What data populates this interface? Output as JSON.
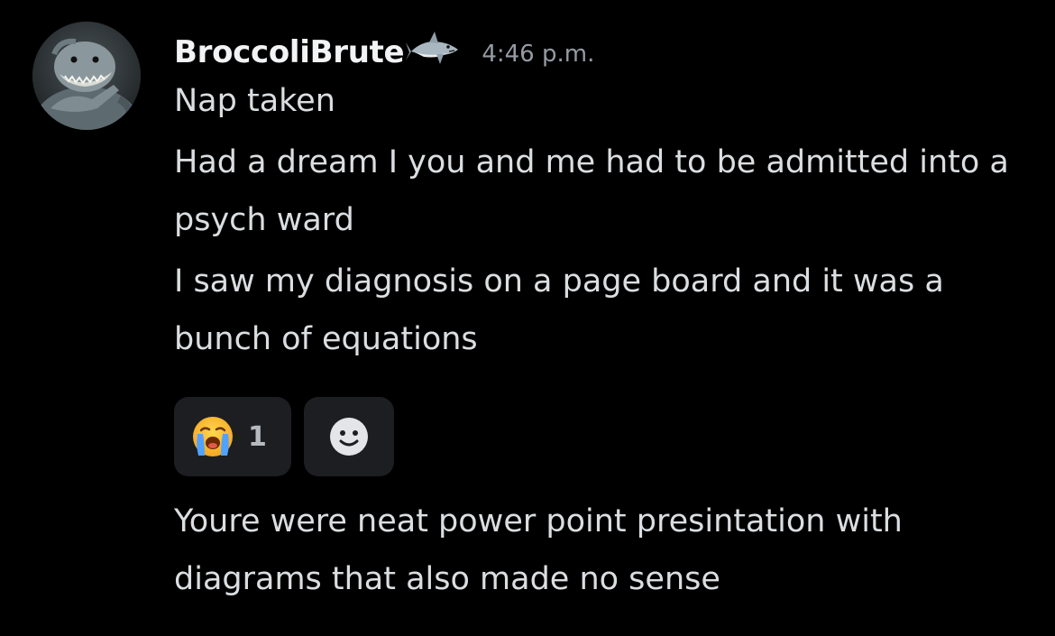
{
  "message": {
    "author": "BroccoliBrute",
    "author_badge_icon": "shark-icon",
    "avatar_icon": "shark-character-avatar",
    "timestamp": "4:46 p.m.",
    "lines": [
      "Nap taken",
      "Had a dream I you and me had to be admitted into a psych ward",
      "I saw my diagnosis on a page board and it was a bunch of equations"
    ],
    "reactions": [
      {
        "icon": "loudly-crying-face-emoji",
        "count": "1"
      }
    ],
    "add_reaction_icon": "smiley-face-icon",
    "followup": "Youre were neat power point presintation with diagrams that also made no sense"
  },
  "colors": {
    "background": "#000000",
    "text": "#dbdee1",
    "username": "#f2f3f5",
    "timestamp": "#949ba4",
    "reaction_bg": "#1d1e21"
  }
}
